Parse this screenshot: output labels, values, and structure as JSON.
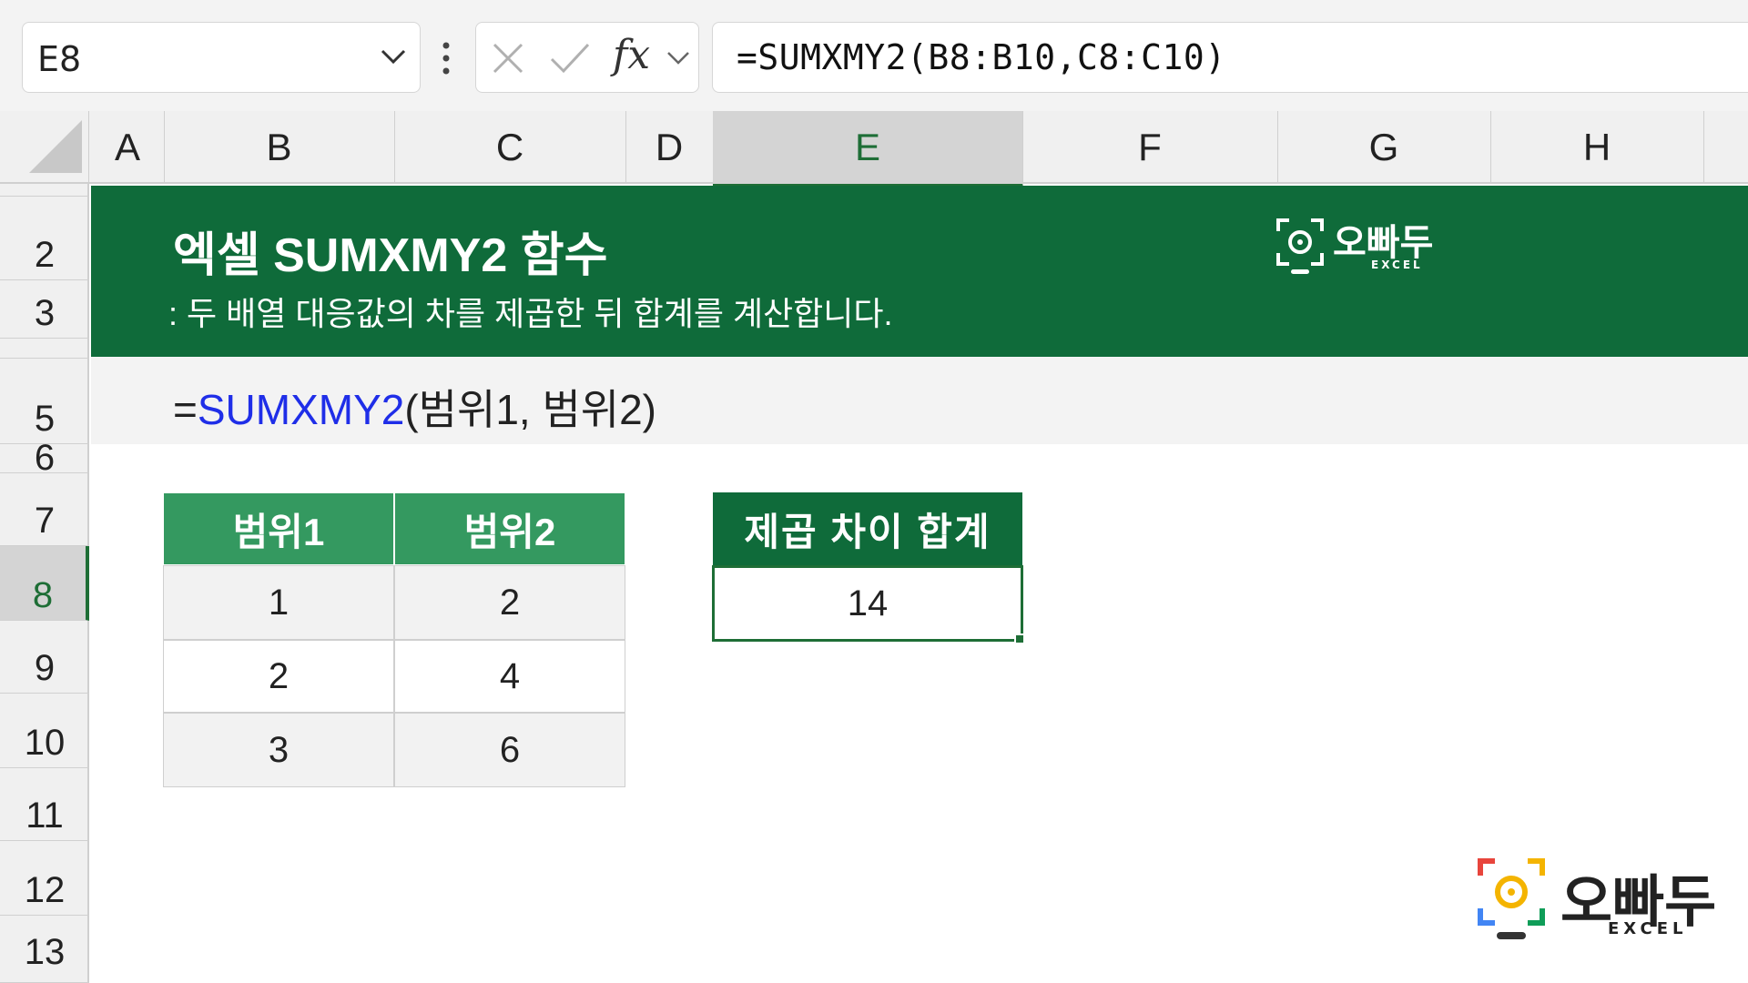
{
  "toolbar": {
    "name_box": "E8",
    "formula": "=SUMXMY2(B8:B10,C8:C10)",
    "fx_label": "fx"
  },
  "columns": [
    "A",
    "B",
    "C",
    "D",
    "E",
    "F",
    "G",
    "H"
  ],
  "selected_column": "E",
  "rows": [
    "2",
    "3",
    "5",
    "6",
    "7",
    "8",
    "9",
    "10",
    "11",
    "12",
    "13"
  ],
  "selected_row": "8",
  "banner": {
    "title": "엑셀 SUMXMY2 함수",
    "subtitle": ": 두 배열 대응값의 차를 제곱한 뒤 합계를 계산합니다.",
    "logo_text": "오빠두",
    "logo_sub": "EXCEL"
  },
  "syntax": {
    "prefix": "=",
    "function": "SUMXMY2",
    "args": "(범위1, 범위2)"
  },
  "table": {
    "headers": [
      "범위1",
      "범위2"
    ],
    "rows": [
      [
        "1",
        "2"
      ],
      [
        "2",
        "4"
      ],
      [
        "3",
        "6"
      ]
    ]
  },
  "result": {
    "header": "제곱 차이 합계",
    "value": "14"
  },
  "corner_logo": {
    "text": "오빠두",
    "sub": "EXCEL"
  },
  "colors": {
    "excel_green": "#1e6e36",
    "banner_green": "#0f6b3a",
    "header_green": "#349960",
    "function_blue": "#1f2ee8"
  }
}
